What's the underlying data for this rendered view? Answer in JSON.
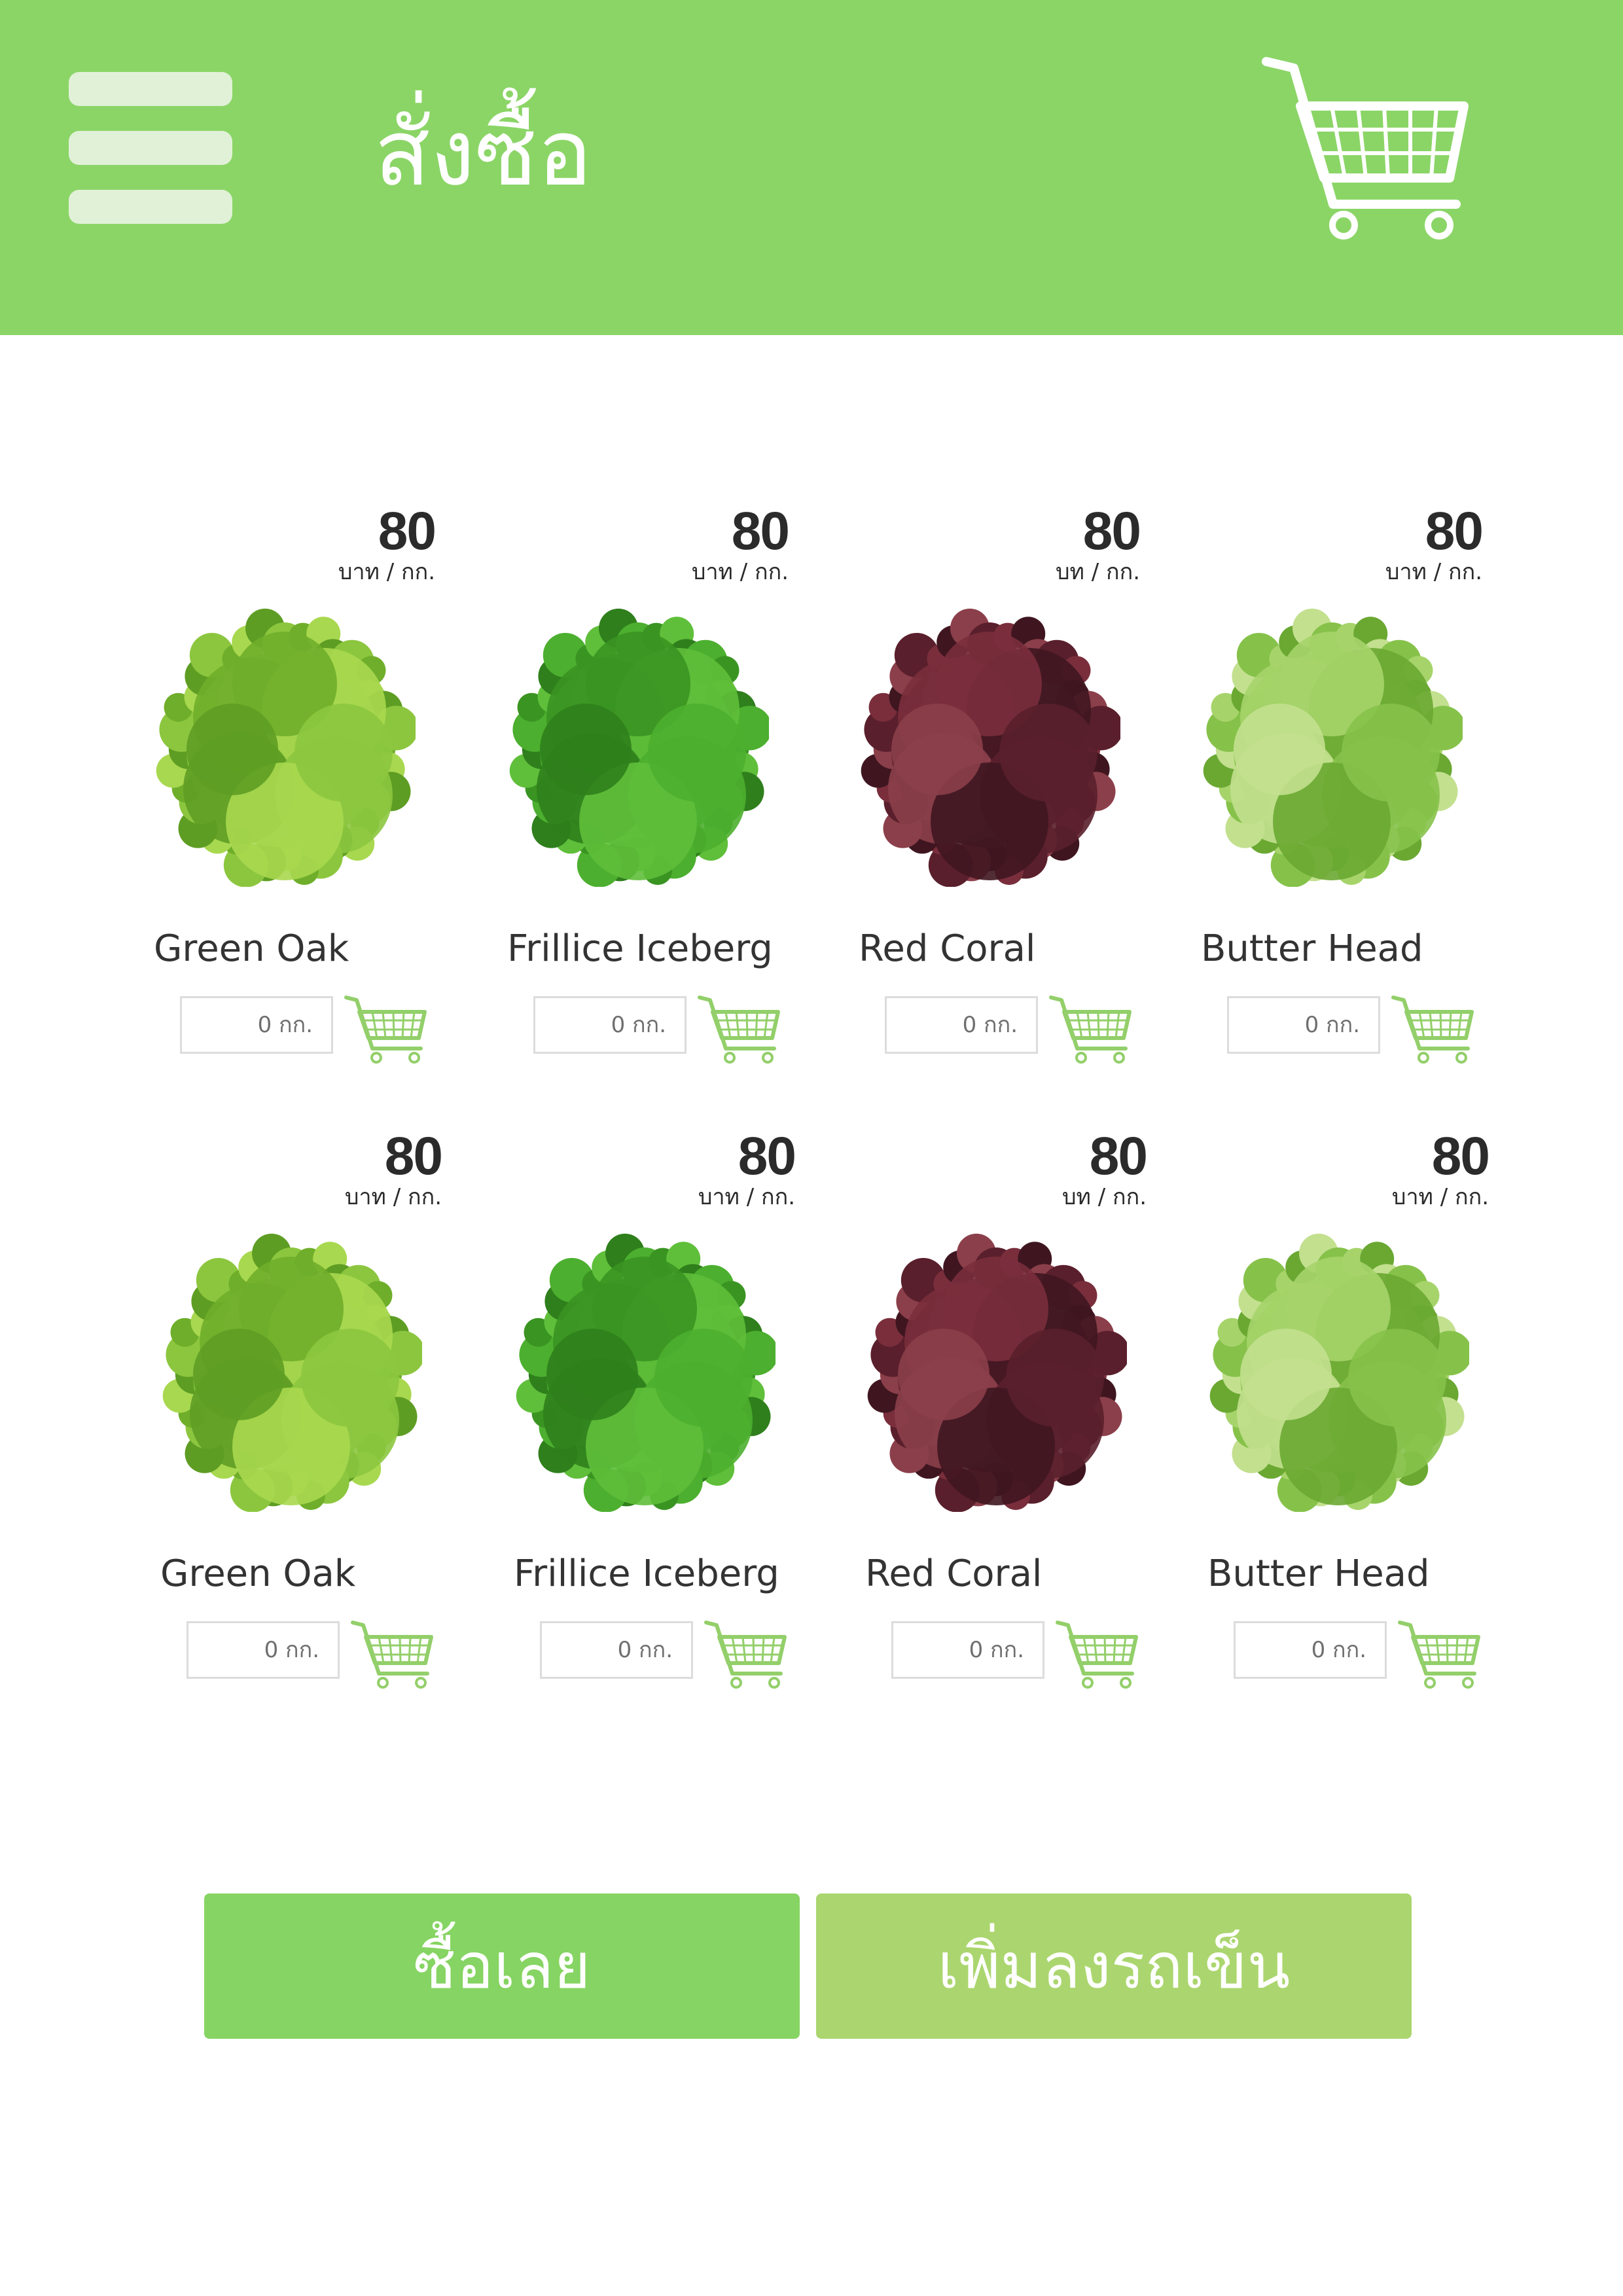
{
  "header": {
    "title": "สั่งซื้อ",
    "icons": {
      "menu": "hamburger-menu-icon",
      "cart": "shopping-cart-icon"
    }
  },
  "products": [
    {
      "name": "Green Oak",
      "price": "80",
      "unit": "บาท / กก.",
      "qty_text": "0 กก.",
      "image": "green-oak-lettuce"
    },
    {
      "name": "Frillice Iceberg",
      "price": "80",
      "unit": "บาท / กก.",
      "qty_text": "0 กก.",
      "image": "frillice-iceberg-lettuce"
    },
    {
      "name": "Red Coral",
      "price": "80",
      "unit": "บท / กก.",
      "qty_text": "0 กก.",
      "image": "red-coral-lettuce"
    },
    {
      "name": "Butter Head",
      "price": "80",
      "unit": "บาท / กก.",
      "qty_text": "0 กก.",
      "image": "butter-head-lettuce"
    },
    {
      "name": "Green Oak",
      "price": "80",
      "unit": "บาท / กก.",
      "qty_text": "0 กก.",
      "image": "green-oak-lettuce"
    },
    {
      "name": "Frillice Iceberg",
      "price": "80",
      "unit": "บาท / กก.",
      "qty_text": "0 กก.",
      "image": "frillice-iceberg-lettuce"
    },
    {
      "name": "Red Coral",
      "price": "80",
      "unit": "บท / กก.",
      "qty_text": "0 กก.",
      "image": "red-coral-lettuce"
    },
    {
      "name": "Butter Head",
      "price": "80",
      "unit": "บาท / กก.",
      "qty_text": "0 กก.",
      "image": "butter-head-lettuce"
    }
  ],
  "actions": {
    "buy_now": "ซื้อเลย",
    "add_to_cart": "เพิ่มลงรถเข็น"
  },
  "colors": {
    "header": "#8bd567",
    "buy_button": "#86d463",
    "add_button": "#abd66f",
    "cart_icon": "#93cf6a"
  }
}
